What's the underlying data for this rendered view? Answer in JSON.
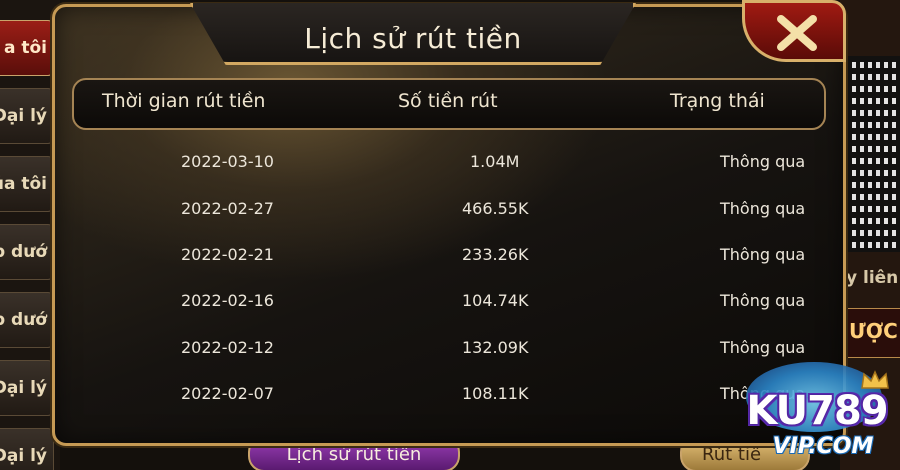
{
  "background": {
    "side_tabs": [
      "a tôi",
      "Đại lý",
      "ủa tôi",
      "ấp dướ",
      "p dướ",
      "Đại lý",
      "Đại lý"
    ],
    "right_labels": [
      "y liên l",
      "ƯỢC"
    ],
    "bottom_buttons": [
      "Lịch sử rút tiền",
      "Rút tiề"
    ]
  },
  "dialog": {
    "title": "Lịch sử rút tiền",
    "close_icon": "close-x-icon",
    "columns": [
      "Thời gian rút tiền",
      "Số tiền rút",
      "Trạng thái"
    ],
    "rows": [
      {
        "date": "2022-03-10",
        "amount": "1.04M",
        "status": "Thông qua"
      },
      {
        "date": "2022-02-27",
        "amount": "466.55K",
        "status": "Thông qua"
      },
      {
        "date": "2022-02-21",
        "amount": "233.26K",
        "status": "Thông qua"
      },
      {
        "date": "2022-02-16",
        "amount": "104.74K",
        "status": "Thông qua"
      },
      {
        "date": "2022-02-12",
        "amount": "132.09K",
        "status": "Thông qua"
      },
      {
        "date": "2022-02-07",
        "amount": "108.11K",
        "status": "Thông qua"
      }
    ]
  },
  "watermark": {
    "brand": "KU789",
    "domain": "VIP.COM"
  },
  "colors": {
    "gold_border": "#c69a54",
    "close_red": "#a01a12",
    "text": "#ece6da"
  }
}
